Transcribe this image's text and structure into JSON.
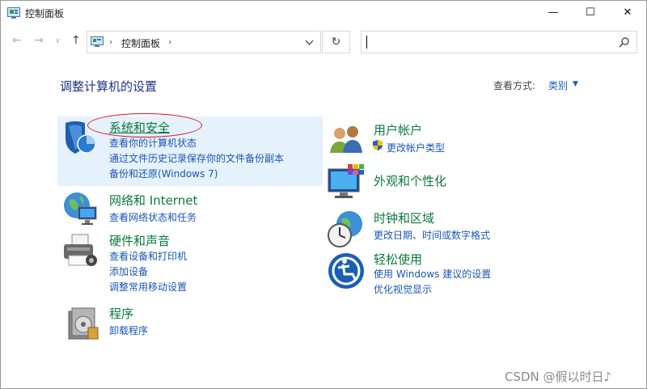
{
  "window": {
    "title": "控制面板",
    "minimize": "—",
    "maximize": "☐",
    "close": "✕"
  },
  "address": {
    "breadcrumb": "控制面板",
    "sep1": "›",
    "sep2": "›"
  },
  "search": {
    "placeholder": ""
  },
  "content": {
    "heading": "调整计算机的设置",
    "view_by_label": "查看方式:",
    "view_by_value": "类别"
  },
  "categories": {
    "system_security": {
      "title": "系统和安全",
      "links": [
        "查看你的计算机状态",
        "通过文件历史记录保存你的文件备份副本",
        "备份和还原(Windows 7)"
      ]
    },
    "network": {
      "title": "网络和 Internet",
      "links": [
        "查看网络状态和任务"
      ]
    },
    "hardware": {
      "title": "硬件和声音",
      "links": [
        "查看设备和打印机",
        "添加设备",
        "调整常用移动设置"
      ]
    },
    "programs": {
      "title": "程序",
      "links": [
        "卸载程序"
      ]
    },
    "user_accounts": {
      "title": "用户帐户",
      "links": [
        "更改帐户类型"
      ]
    },
    "appearance": {
      "title": "外观和个性化",
      "links": []
    },
    "clock_region": {
      "title": "时钟和区域",
      "links": [
        "更改日期、时间或数字格式"
      ]
    },
    "ease_access": {
      "title": "轻松使用",
      "links": [
        "使用 Windows 建议的设置",
        "优化视觉显示"
      ]
    }
  },
  "watermark": "CSDN @假以时日♪",
  "colors": {
    "accent": "#1a56b8",
    "category_title": "#0a7a3c",
    "highlight_bg": "#e5f1fb",
    "annotation_oval": "#e0102a"
  }
}
